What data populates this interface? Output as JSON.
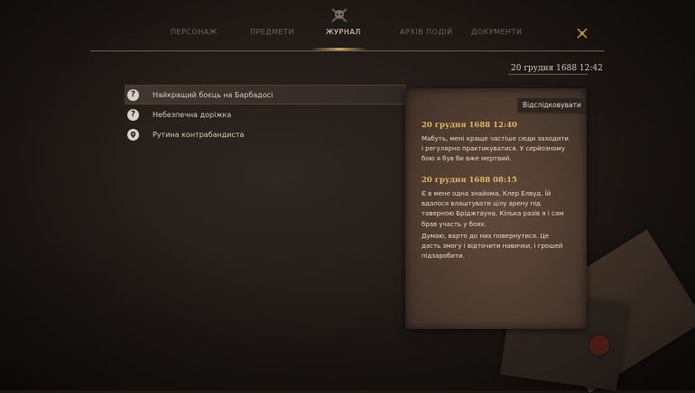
{
  "nav": {
    "tabs": [
      {
        "label": "ПЕРСОНАЖ"
      },
      {
        "label": "ПРЕДМЕТИ"
      },
      {
        "label": "ЖУРНАЛ"
      },
      {
        "label": "АРХІВ ПОДІЙ"
      },
      {
        "label": "ДОКУМЕНТИ"
      }
    ],
    "active_tab": "ЖУРНАЛ",
    "active_icon": "skull-crossbones-icon",
    "close_icon": "close-icon"
  },
  "current_date": "20 грудня 1688 12:42",
  "quests": [
    {
      "label": "Найкращий боєць на Барбадосі",
      "icon": "question-icon",
      "selected": true
    },
    {
      "label": "Небезпечна доріжка",
      "icon": "question-icon",
      "selected": false
    },
    {
      "label": "Рутина контрабандиста",
      "icon": "location-pin-icon",
      "selected": false
    }
  ],
  "journal": {
    "track_button": "Відслідковувати",
    "entries": [
      {
        "date": "20 грудня 1688 12:40",
        "paragraphs": [
          "Мабуть, мені краще частіше сюди заходити і регулярно практикуватися. У серйозному бою я був би вже мертвий."
        ]
      },
      {
        "date": "20 грудня 1688 08:15",
        "paragraphs": [
          "Є в мене одна знайома, Клер Елвуд. Їй вдалося влаштувати цілу арену під таверною Бріджтауна. Кілька разів я і сам брав участь у боях.",
          "Думаю, варто до них повернутися. Це дасть змогу і відточити навички, і грошей підзаробити."
        ]
      }
    ]
  },
  "colors": {
    "accent": "#e7b461",
    "paper": "#4e3c30",
    "background": "#1f1916"
  }
}
